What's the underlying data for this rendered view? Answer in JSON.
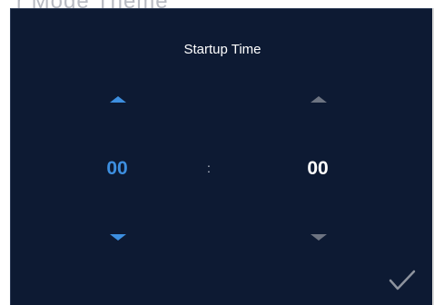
{
  "background": {
    "title_fragment": "r Mode Theme"
  },
  "dialog": {
    "title": "Startup Time",
    "separator": ":",
    "hour": {
      "value": "00",
      "color": "#3d8fe0"
    },
    "minute": {
      "value": "00",
      "color": "#ffffff",
      "arrow_color": "#6d7482"
    },
    "confirm_icon": "check-icon",
    "confirm_color": "#8d939e"
  }
}
